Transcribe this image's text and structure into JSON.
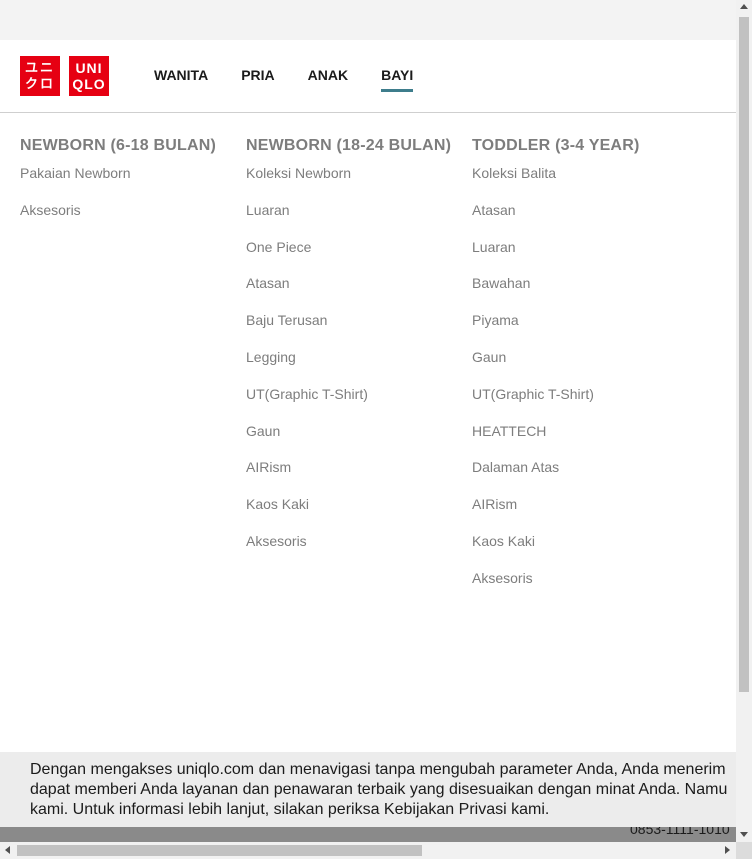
{
  "brand": {
    "logo_katakana": "ユニクロ",
    "logo_latin_top": "UNI",
    "logo_latin_bottom": "QLO",
    "color": "#e60012"
  },
  "nav": {
    "items": [
      {
        "label": "WANITA",
        "active": false
      },
      {
        "label": "PRIA",
        "active": false
      },
      {
        "label": "ANAK",
        "active": false
      },
      {
        "label": "BAYI",
        "active": true
      }
    ],
    "active_color": "#3e7d8c"
  },
  "menu": {
    "columns": [
      {
        "title": "NEWBORN (6-18 BULAN)",
        "items": [
          "Pakaian Newborn",
          "Aksesoris"
        ]
      },
      {
        "title": "NEWBORN (18-24 BULAN)",
        "items": [
          "Koleksi Newborn",
          "Luaran",
          "One Piece",
          "Atasan",
          "Baju Terusan",
          "Legging",
          "UT(Graphic T-Shirt)",
          "Gaun",
          "AIRism",
          "Kaos Kaki",
          "Aksesoris"
        ]
      },
      {
        "title": "TODDLER (3-4 YEAR)",
        "items": [
          "Koleksi Balita",
          "Atasan",
          "Luaran",
          "Bawahan",
          "Piyama",
          "Gaun",
          "UT(Graphic T-Shirt)",
          "HEATTECH",
          "Dalaman Atas",
          "AIRism",
          "Kaos Kaki",
          "Aksesoris"
        ]
      }
    ]
  },
  "cookie_notice": {
    "line1": "Dengan mengakses uniqlo.com dan menavigasi tanpa mengubah parameter Anda, Anda menerim",
    "line2": "dapat memberi Anda layanan dan penawaran terbaik yang disesuaikan dengan minat Anda. Namu",
    "line3": "kami. Untuk informasi lebih lanjut, silakan periksa Kebijakan Privasi kami."
  },
  "footer": {
    "phone": "0853-1111-1010"
  }
}
